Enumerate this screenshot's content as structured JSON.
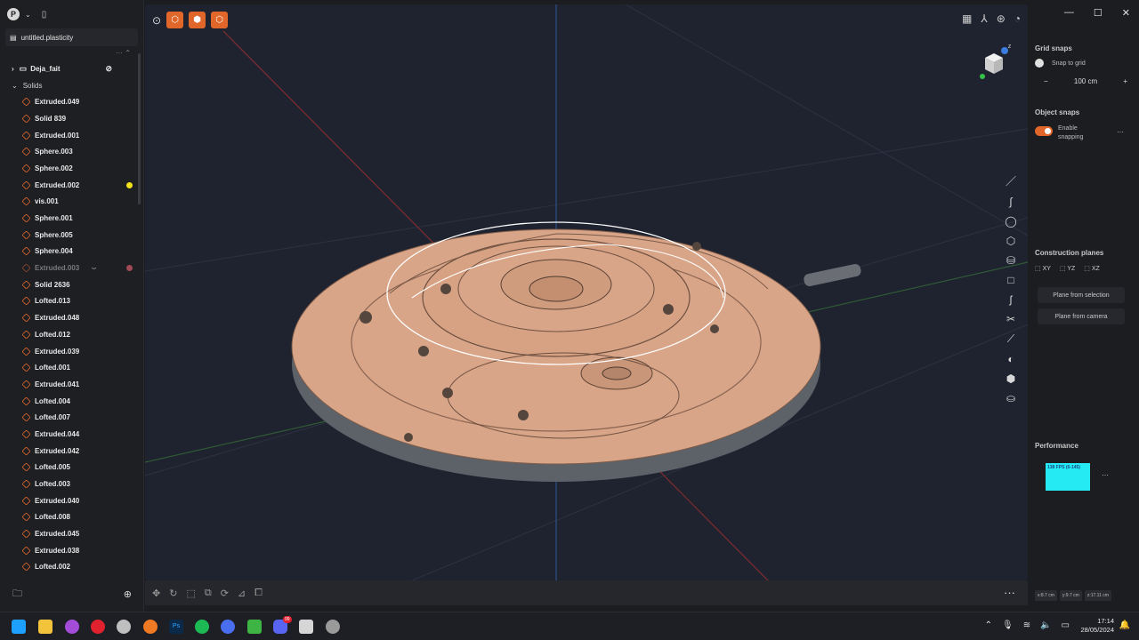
{
  "file": {
    "name": "untitled.plasticity"
  },
  "outliner": {
    "group": "Deja_fait",
    "section": "Solids",
    "items": [
      {
        "label": "Extruded.049"
      },
      {
        "label": "Solid 839"
      },
      {
        "label": "Extruded.001"
      },
      {
        "label": "Sphere.003"
      },
      {
        "label": "Sphere.002"
      },
      {
        "label": "Extruded.002",
        "marker": "#f2e21a"
      },
      {
        "label": "vis.001"
      },
      {
        "label": "Sphere.001"
      },
      {
        "label": "Sphere.005"
      },
      {
        "label": "Sphere.004"
      },
      {
        "label": "Extruded.003",
        "hidden": true,
        "marker": "#a04a55"
      },
      {
        "label": "Solid 2636"
      },
      {
        "label": "Lofted.013"
      },
      {
        "label": "Extruded.048"
      },
      {
        "label": "Lofted.012"
      },
      {
        "label": "Extruded.039"
      },
      {
        "label": "Lofted.001"
      },
      {
        "label": "Extruded.041"
      },
      {
        "label": "Lofted.004"
      },
      {
        "label": "Lofted.007"
      },
      {
        "label": "Extruded.044"
      },
      {
        "label": "Extruded.042"
      },
      {
        "label": "Lofted.005"
      },
      {
        "label": "Lofted.003"
      },
      {
        "label": "Extruded.040"
      },
      {
        "label": "Lofted.008"
      },
      {
        "label": "Extruded.045"
      },
      {
        "label": "Extruded.038"
      },
      {
        "label": "Lofted.002"
      }
    ]
  },
  "snaps": {
    "grid_title": "Grid snaps",
    "snap_to_grid": "Snap to grid",
    "grid_value": "100 cm",
    "object_title": "Object snaps",
    "enable_snapping": "Enable snapping"
  },
  "construction": {
    "title": "Construction planes",
    "planes": [
      "XY",
      "YZ",
      "XZ"
    ],
    "plane_from_selection": "Plane from selection",
    "plane_from_camera": "Plane from camera"
  },
  "performance": {
    "title": "Performance",
    "fps": "138 FPS (6-145)"
  },
  "coords": [
    "x:8.7 cm",
    "y:9.7 cm",
    "z:17.11 cm"
  ],
  "navcube_badge": "Z",
  "taskbar": {
    "time": "17:14",
    "date": "28/05/2024",
    "badge": "99"
  },
  "colors": {
    "accent": "#e0662a",
    "model": "#d9a588",
    "viewport": "#1f2330"
  }
}
